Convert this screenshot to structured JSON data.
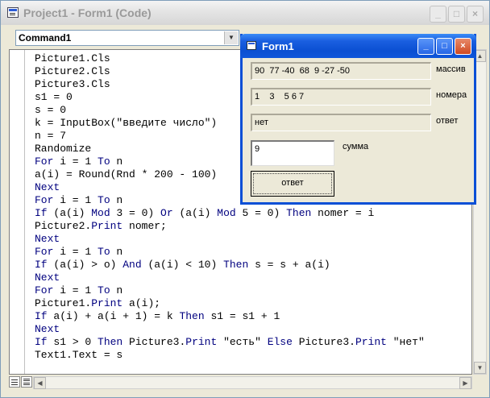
{
  "main_window": {
    "title": "Project1 - Form1 (Code)",
    "object_combo": "Command1",
    "minimize": "_",
    "maximize": "□",
    "close": "×"
  },
  "code_lines": [
    [
      {
        "t": "Picture1.Cls",
        "k": 0
      }
    ],
    [
      {
        "t": "Picture2.Cls",
        "k": 0
      }
    ],
    [
      {
        "t": "Picture3.Cls",
        "k": 0
      }
    ],
    [
      {
        "t": "s1 = 0",
        "k": 0
      }
    ],
    [
      {
        "t": "s = 0",
        "k": 0
      }
    ],
    [
      {
        "t": "k = InputBox(\"введите число\")",
        "k": 0
      }
    ],
    [
      {
        "t": "n = 7",
        "k": 0
      }
    ],
    [
      {
        "t": "Randomize",
        "k": 0
      }
    ],
    [
      {
        "t": "For",
        "k": 1
      },
      {
        "t": " i = 1 ",
        "k": 0
      },
      {
        "t": "To",
        "k": 1
      },
      {
        "t": " n",
        "k": 0
      }
    ],
    [
      {
        "t": "a(i) = Round(Rnd * 200 - 100)",
        "k": 0
      }
    ],
    [
      {
        "t": "Next",
        "k": 1
      }
    ],
    [
      {
        "t": "For",
        "k": 1
      },
      {
        "t": " i = 1 ",
        "k": 0
      },
      {
        "t": "To",
        "k": 1
      },
      {
        "t": " n",
        "k": 0
      }
    ],
    [
      {
        "t": "If",
        "k": 1
      },
      {
        "t": " (a(i) ",
        "k": 0
      },
      {
        "t": "Mod",
        "k": 1
      },
      {
        "t": " 3 = 0) ",
        "k": 0
      },
      {
        "t": "Or",
        "k": 1
      },
      {
        "t": " (a(i) ",
        "k": 0
      },
      {
        "t": "Mod",
        "k": 1
      },
      {
        "t": " 5 = 0) ",
        "k": 0
      },
      {
        "t": "Then",
        "k": 1
      },
      {
        "t": " nomer = i",
        "k": 0
      }
    ],
    [
      {
        "t": "Picture2.",
        "k": 0
      },
      {
        "t": "Print",
        "k": 1
      },
      {
        "t": " nomer;",
        "k": 0
      }
    ],
    [
      {
        "t": "Next",
        "k": 1
      }
    ],
    [
      {
        "t": "For",
        "k": 1
      },
      {
        "t": " i = 1 ",
        "k": 0
      },
      {
        "t": "To",
        "k": 1
      },
      {
        "t": " n",
        "k": 0
      }
    ],
    [
      {
        "t": "If",
        "k": 1
      },
      {
        "t": " (a(i) > o) ",
        "k": 0
      },
      {
        "t": "And",
        "k": 1
      },
      {
        "t": " (a(i) < 10) ",
        "k": 0
      },
      {
        "t": "Then",
        "k": 1
      },
      {
        "t": " s = s + a(i)",
        "k": 0
      }
    ],
    [
      {
        "t": "Next",
        "k": 1
      }
    ],
    [
      {
        "t": "For",
        "k": 1
      },
      {
        "t": " i = 1 ",
        "k": 0
      },
      {
        "t": "To",
        "k": 1
      },
      {
        "t": " n",
        "k": 0
      }
    ],
    [
      {
        "t": "Picture1.",
        "k": 0
      },
      {
        "t": "Print",
        "k": 1
      },
      {
        "t": " a(i);",
        "k": 0
      }
    ],
    [
      {
        "t": "If",
        "k": 1
      },
      {
        "t": " a(i) + a(i + 1) = k ",
        "k": 0
      },
      {
        "t": "Then",
        "k": 1
      },
      {
        "t": " s1 = s1 + 1",
        "k": 0
      }
    ],
    [
      {
        "t": "Next",
        "k": 1
      }
    ],
    [
      {
        "t": "If",
        "k": 1
      },
      {
        "t": " s1 > 0 ",
        "k": 0
      },
      {
        "t": "Then",
        "k": 1
      },
      {
        "t": " Picture3.",
        "k": 0
      },
      {
        "t": "Print",
        "k": 1
      },
      {
        "t": " \"есть\" ",
        "k": 0
      },
      {
        "t": "Else",
        "k": 1
      },
      {
        "t": " Picture3.",
        "k": 0
      },
      {
        "t": "Print",
        "k": 1
      },
      {
        "t": " \"нет\"",
        "k": 0
      }
    ],
    [
      {
        "t": "Text1.Text = s",
        "k": 0
      }
    ]
  ],
  "form1": {
    "title": "Form1",
    "picture1_value": "90  77 -40  68  9 -27 -50",
    "picture1_label": "массив",
    "picture2_value": "1    3    5 6 7",
    "picture2_label": "номера",
    "picture3_value": "нет",
    "picture3_label": "ответ",
    "text1_value": "9",
    "text1_label": "сумма",
    "command_label": "ответ",
    "minimize": "_",
    "maximize": "□",
    "close": "×"
  },
  "colors": {
    "keyword": "#00007f",
    "form_title": "#0b4fd2"
  }
}
